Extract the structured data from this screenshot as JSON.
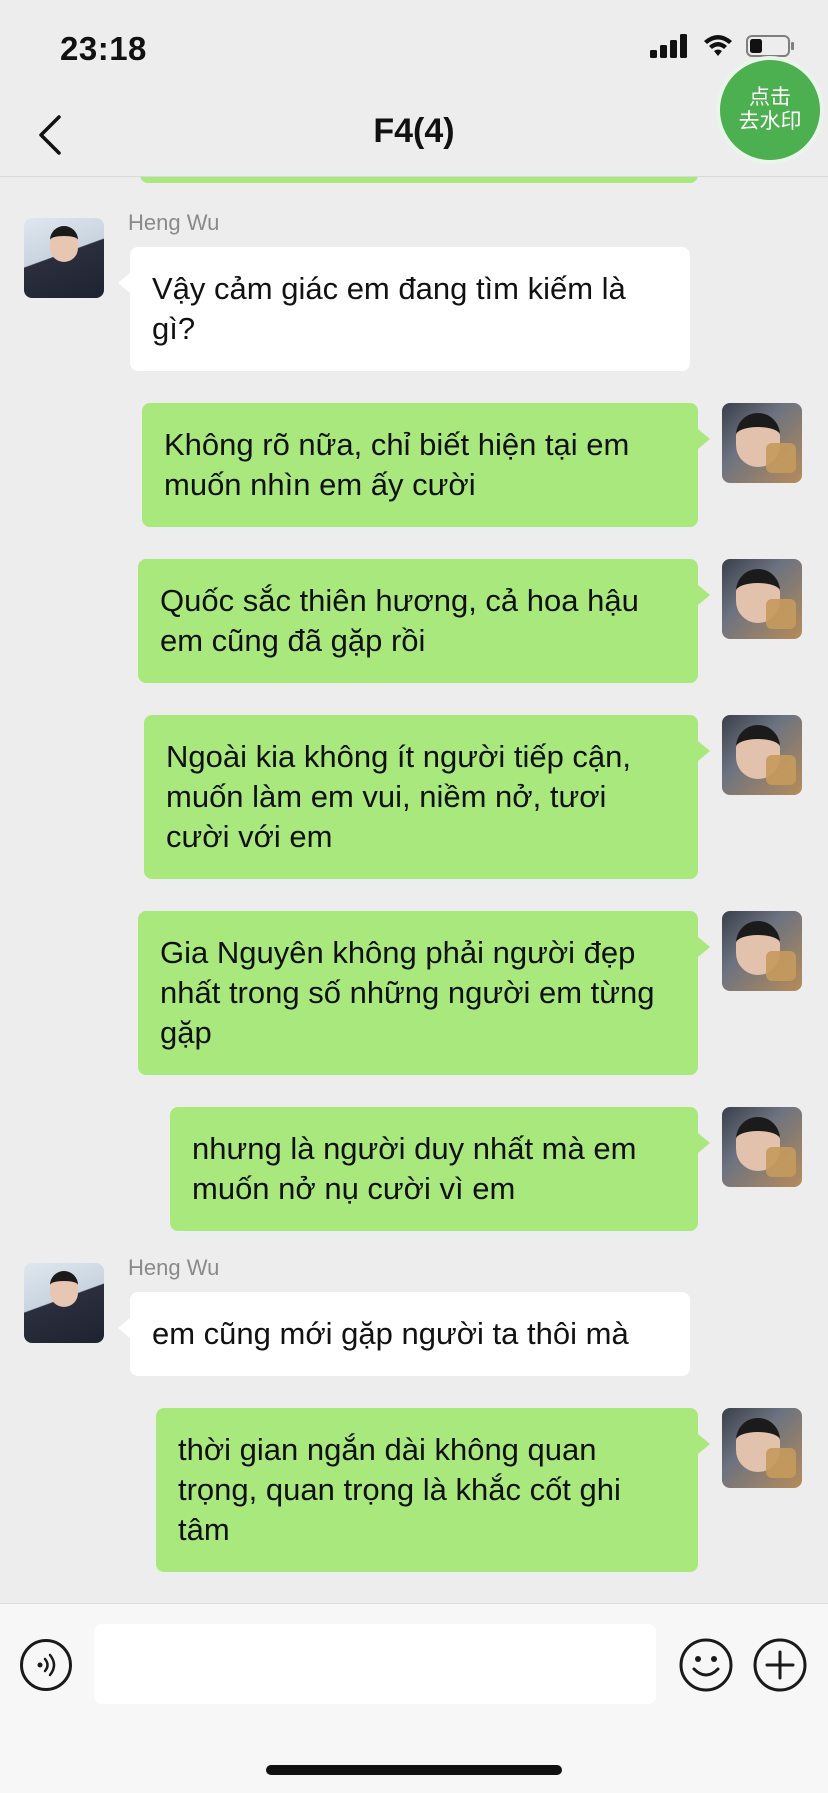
{
  "status_bar": {
    "time": "23:18"
  },
  "nav": {
    "title": "F4(4)",
    "watermark_line1": "点击",
    "watermark_line2": "去水印"
  },
  "messages": [
    {
      "side": "in",
      "sender": "Heng Wu",
      "text": "Vậy cảm giác em đang tìm kiếm là gì?"
    },
    {
      "side": "out",
      "text": "Không rõ nữa, chỉ biết hiện tại em muốn nhìn em ấy cười"
    },
    {
      "side": "out",
      "text": "Quốc sắc thiên hương, cả hoa hậu em cũng đã gặp rồi"
    },
    {
      "side": "out",
      "text": "Ngoài kia không ít người tiếp cận, muốn làm em vui, niềm nở, tươi cười với em"
    },
    {
      "side": "out",
      "text": "Gia Nguyên không phải người đẹp nhất trong số những người em từng gặp"
    },
    {
      "side": "out",
      "text": "nhưng là người duy nhất mà em muốn nở nụ cười vì em"
    },
    {
      "side": "in",
      "sender": "Heng Wu",
      "text": "em cũng mới gặp người ta thôi mà"
    },
    {
      "side": "out",
      "text": "thời gian ngắn dài không quan trọng, quan trọng là khắc cốt ghi tâm"
    }
  ],
  "input": {
    "value": "",
    "placeholder": ""
  },
  "colors": {
    "background": "#EDEDED",
    "outgoing_bubble": "#A9E87D",
    "incoming_bubble": "#FFFFFF",
    "badge": "#4CAF50"
  },
  "icons": {
    "back": "chevron-left-icon",
    "voice": "voice-icon",
    "emoji": "emoji-icon",
    "more": "plus-icon"
  }
}
